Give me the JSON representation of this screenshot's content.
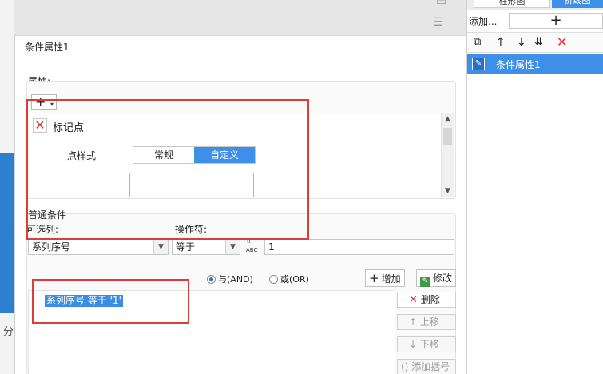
{
  "dialog": {
    "title": "条件属性1"
  },
  "attributes": {
    "label": "属性:",
    "add_symbol": "+",
    "marker_label": "标记点",
    "point_style_label": "点样式",
    "options": [
      "常规",
      "自定义"
    ],
    "selected_option": "自定义"
  },
  "conditions": {
    "label": "普通条件",
    "column_label": "可选列:",
    "operator_label": "操作符:",
    "column_value": "系列序号",
    "operator_value": "等于",
    "value": "1",
    "type_icon_text": "ABC",
    "and_label": "与(AND)",
    "or_label": "或(OR)",
    "selected_logic": "and",
    "add_label": "增加",
    "edit_label": "修改",
    "items": [
      "系列序号 等于 '1'"
    ],
    "delete_label": "删除",
    "up_label": "上移",
    "down_label": "下移",
    "paren_label": "添加括号"
  },
  "background": {
    "partial_text": "分"
  },
  "right_panel": {
    "tabs": [
      "柱形图",
      "折线图"
    ],
    "add_label": "添加...",
    "add_symbol": "+",
    "items": [
      "条件属性1"
    ]
  },
  "colors": {
    "accent": "#3e8fe8",
    "annotation": "#e03a3a",
    "delete_red": "#e03434"
  }
}
